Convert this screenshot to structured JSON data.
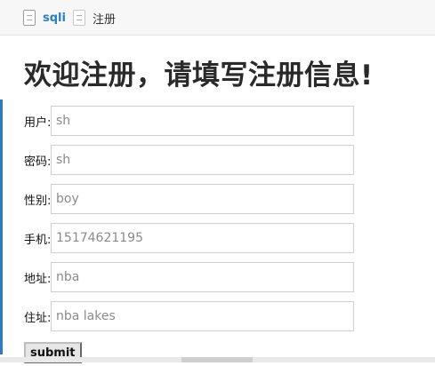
{
  "tabs": [
    {
      "label": "sqli",
      "icon": "file-icon",
      "active": true
    },
    {
      "label": "注册",
      "icon": "file-icon",
      "active": false
    }
  ],
  "form": {
    "heading": "欢迎注册，请填写注册信息!",
    "fields": [
      {
        "label": "用户:",
        "value": "sh"
      },
      {
        "label": "密码:",
        "value": "sh"
      },
      {
        "label": "性别:",
        "value": "boy"
      },
      {
        "label": "手机:",
        "value": "15174621195"
      },
      {
        "label": "地址:",
        "value": "nba"
      },
      {
        "label": "住址:",
        "value": "nba lakes"
      }
    ],
    "submit_label": "submit"
  },
  "colors": {
    "accent": "#2c7cbf",
    "tab_link": "#2a7fc1"
  }
}
